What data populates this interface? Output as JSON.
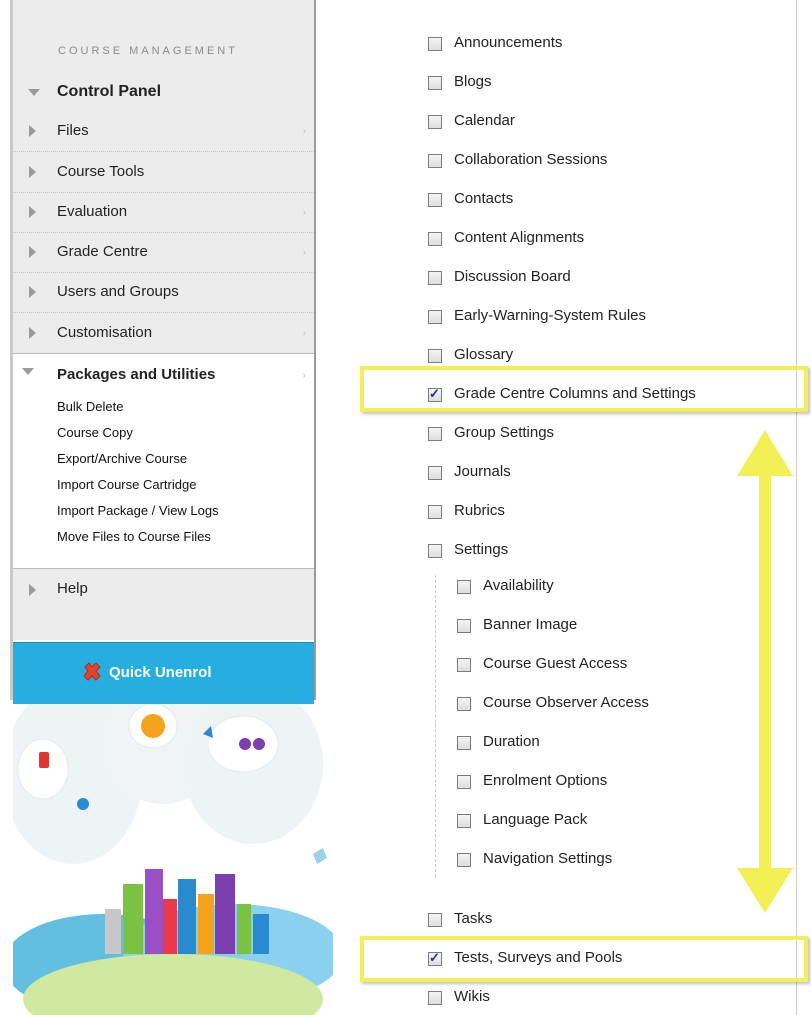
{
  "sidebar": {
    "section_title": "COURSE MANAGEMENT",
    "control_panel_label": "Control Panel",
    "items": [
      {
        "label": "Files",
        "has_chevron": true
      },
      {
        "label": "Course Tools",
        "has_chevron": false
      },
      {
        "label": "Evaluation",
        "has_chevron": true
      },
      {
        "label": "Grade Centre",
        "has_chevron": true
      },
      {
        "label": "Users and Groups",
        "has_chevron": false
      },
      {
        "label": "Customisation",
        "has_chevron": true
      }
    ],
    "packages": {
      "label": "Packages and Utilities",
      "links": [
        "Bulk Delete",
        "Course Copy",
        "Export/Archive Course",
        "Import Course Cartridge",
        "Import Package / View Logs",
        "Move Files to Course Files"
      ]
    },
    "help_label": "Help",
    "quick_unenrol_label": "Quick Unenrol",
    "chevron_char": "›"
  },
  "options": {
    "main": [
      {
        "label": "Announcements",
        "checked": false
      },
      {
        "label": "Blogs",
        "checked": false
      },
      {
        "label": "Calendar",
        "checked": false
      },
      {
        "label": "Collaboration Sessions",
        "checked": false
      },
      {
        "label": "Contacts",
        "checked": false
      },
      {
        "label": "Content Alignments",
        "checked": false
      },
      {
        "label": "Discussion Board",
        "checked": false
      },
      {
        "label": "Early-Warning-System Rules",
        "checked": false
      },
      {
        "label": "Glossary",
        "checked": false
      },
      {
        "label": "Grade Centre Columns and Settings",
        "checked": true
      },
      {
        "label": "Group Settings",
        "checked": false
      },
      {
        "label": "Journals",
        "checked": false
      },
      {
        "label": "Rubrics",
        "checked": false
      },
      {
        "label": "Settings",
        "checked": false
      }
    ],
    "settings_children": [
      {
        "label": "Availability",
        "checked": false
      },
      {
        "label": "Banner Image",
        "checked": false
      },
      {
        "label": "Course Guest Access",
        "checked": false
      },
      {
        "label": "Course Observer Access",
        "checked": false
      },
      {
        "label": "Duration",
        "checked": false
      },
      {
        "label": "Enrolment Options",
        "checked": false
      },
      {
        "label": "Language Pack",
        "checked": false
      },
      {
        "label": "Navigation Settings",
        "checked": false
      }
    ],
    "tail": [
      {
        "label": "Tasks",
        "checked": false
      },
      {
        "label": "Tests, Surveys and Pools",
        "checked": true
      },
      {
        "label": "Wikis",
        "checked": false
      }
    ]
  },
  "colors": {
    "accent_blue": "#26aee0",
    "highlight_yellow": "#f2f055",
    "unenrol_x_red": "#e8402a"
  }
}
